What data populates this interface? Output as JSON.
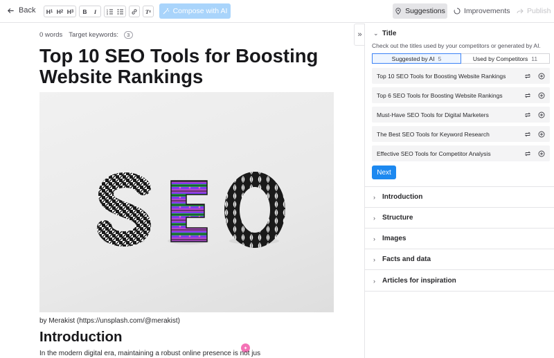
{
  "toolbar": {
    "back_label": "Back",
    "format_buttons": [
      "H1",
      "H2",
      "H3",
      "B",
      "I"
    ],
    "compose_label": "Compose with AI",
    "suggestions_label": "Suggestions",
    "improvements_label": "Improvements",
    "publish_label": "Publish"
  },
  "editor": {
    "word_count": "0 words",
    "target_keywords_label": "Target keywords:",
    "target_keywords_count": "3",
    "title": "Top 10 SEO Tools for Boosting Website Rankings",
    "image_caption": "by Merakist (https://unsplash.com/@merakist)",
    "heading_intro": "Introduction",
    "intro_paragraph": "In the modern digital era, maintaining a robust online presence is not jus",
    "ai_badge": "✦"
  },
  "sidebar": {
    "title_section": {
      "label": "Title",
      "description": "Check out the titles used by your competitors or generated by AI.",
      "tab_ai_label": "Suggested by AI",
      "tab_ai_count": "5",
      "tab_comp_label": "Used by Competitors",
      "tab_comp_count": "11",
      "titles": [
        "Top 10 SEO Tools for Boosting Website Rankings",
        "Top 6 SEO Tools for Boosting Website Rankings",
        "Must-Have SEO Tools for Digital Marketers",
        "The Best SEO Tools for Keyword Research",
        "Effective SEO Tools for Competitor Analysis"
      ],
      "next_label": "Next"
    },
    "sections": [
      "Introduction",
      "Structure",
      "Images",
      "Facts and data",
      "Articles for inspiration"
    ]
  },
  "colors": {
    "accent": "#1d89f0",
    "compose_disabled": "#a9d4fb",
    "ai_pink": "#f472b6"
  }
}
